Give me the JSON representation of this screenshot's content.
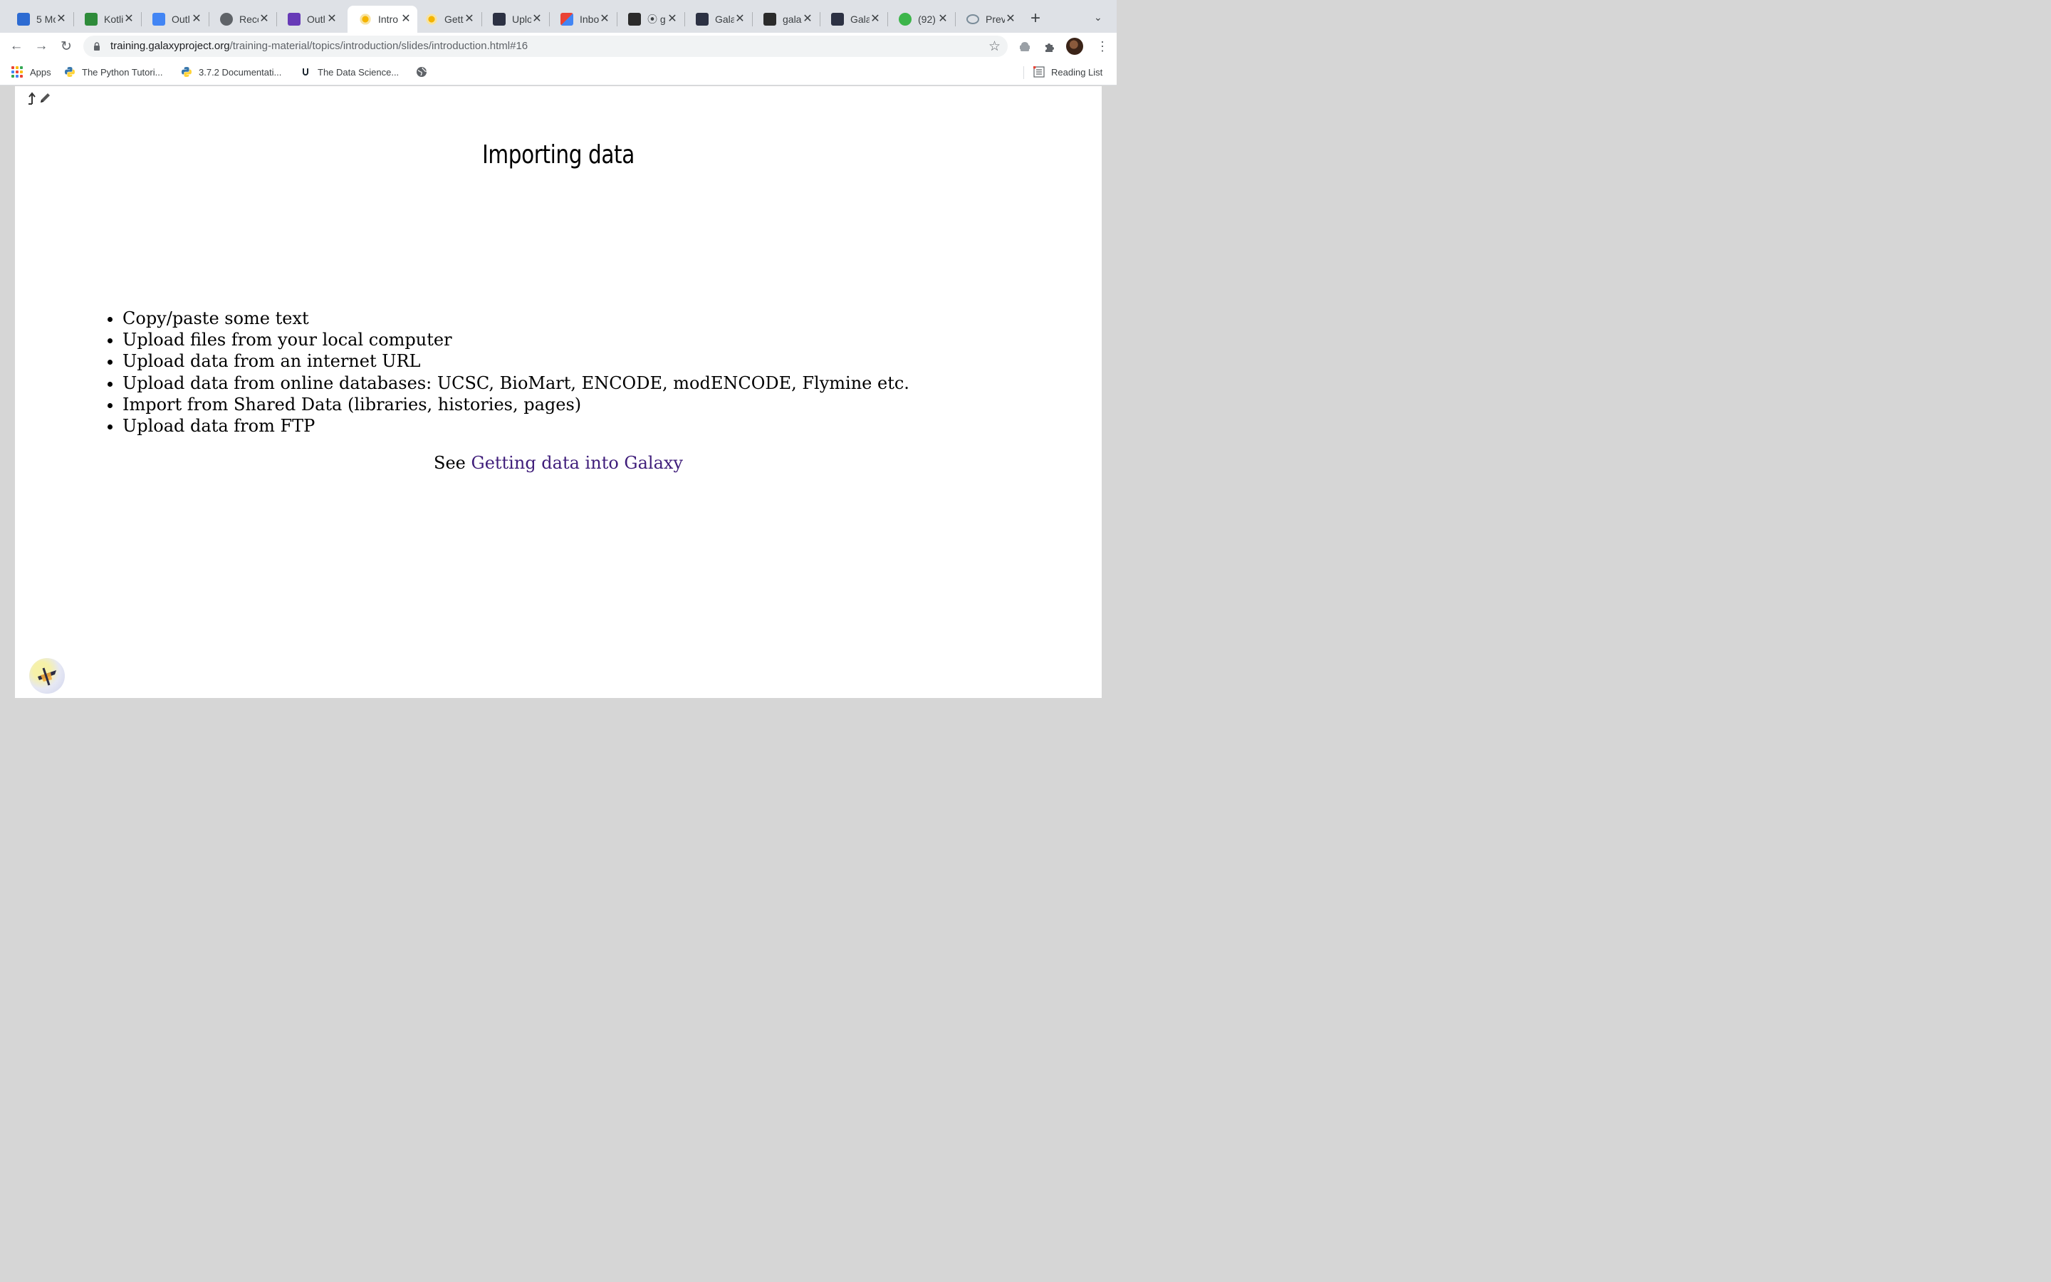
{
  "tabs": [
    {
      "title": "5 Mo",
      "icon": "trello-icon",
      "color": "#2d6bd2"
    },
    {
      "title": "Kotli",
      "icon": "kotlin-mark-icon",
      "color": "#2e8b3a"
    },
    {
      "title": "Outl",
      "icon": "docs-icon",
      "color": "#4285f4"
    },
    {
      "title": "Reco",
      "icon": "globe-icon",
      "color": "#5f6368"
    },
    {
      "title": "Outl",
      "icon": "forms-icon",
      "color": "#673ab7"
    },
    {
      "title": "Intro",
      "icon": "galaxy-icon",
      "color": "#f4b400"
    },
    {
      "title": "Gett",
      "icon": "galaxy-icon",
      "color": "#f4b400"
    },
    {
      "title": "Uplo",
      "icon": "galaxy-hub-icon",
      "color": "#2c3143"
    },
    {
      "title": "Inbo",
      "icon": "gmail-icon",
      "color": "#ea4335"
    },
    {
      "title": "⦿ g",
      "icon": "bars-icon",
      "color": "#2b2b2b"
    },
    {
      "title": "Gala",
      "icon": "galaxy-hub-icon",
      "color": "#2c3143"
    },
    {
      "title": "gala",
      "icon": "bars-icon",
      "color": "#2b2b2b"
    },
    {
      "title": "Gala",
      "icon": "galaxy-hub-icon",
      "color": "#2c3143"
    },
    {
      "title": "(92)",
      "icon": "badge-92-icon",
      "color": "#3cb54a"
    },
    {
      "title": "Prev",
      "icon": "loop-icon",
      "color": "#7a8c99"
    }
  ],
  "toolbar": {
    "url_host": "training.galaxyproject.org",
    "url_path": "/training-material/topics/introduction/slides/introduction.html#16"
  },
  "bookmarks": {
    "apps": "Apps",
    "items": [
      "The Python Tutori...",
      "3.7.2 Documentati...",
      "The Data Science..."
    ],
    "reading_list": "Reading List"
  },
  "slide": {
    "title": "Importing data",
    "bullets": [
      "Copy/paste some text",
      "Upload files from your local computer",
      "Upload data from an internet URL",
      "Upload data from online databases: UCSC, BioMart, ENCODE, modENCODE, Flymine etc.",
      "Import from Shared Data (libraries, histories, pages)",
      "Upload data from FTP"
    ],
    "see_prefix": "See",
    "see_link": "Getting data into Galaxy"
  },
  "colors": {
    "link": "#3f1d7a",
    "tabstrip": "#dee1e6",
    "apps_dots": [
      "#ea4335",
      "#fbbc04",
      "#34a853",
      "#4285f4",
      "#ea4335",
      "#fbbc04",
      "#34a853",
      "#4285f4",
      "#ea4335"
    ]
  }
}
